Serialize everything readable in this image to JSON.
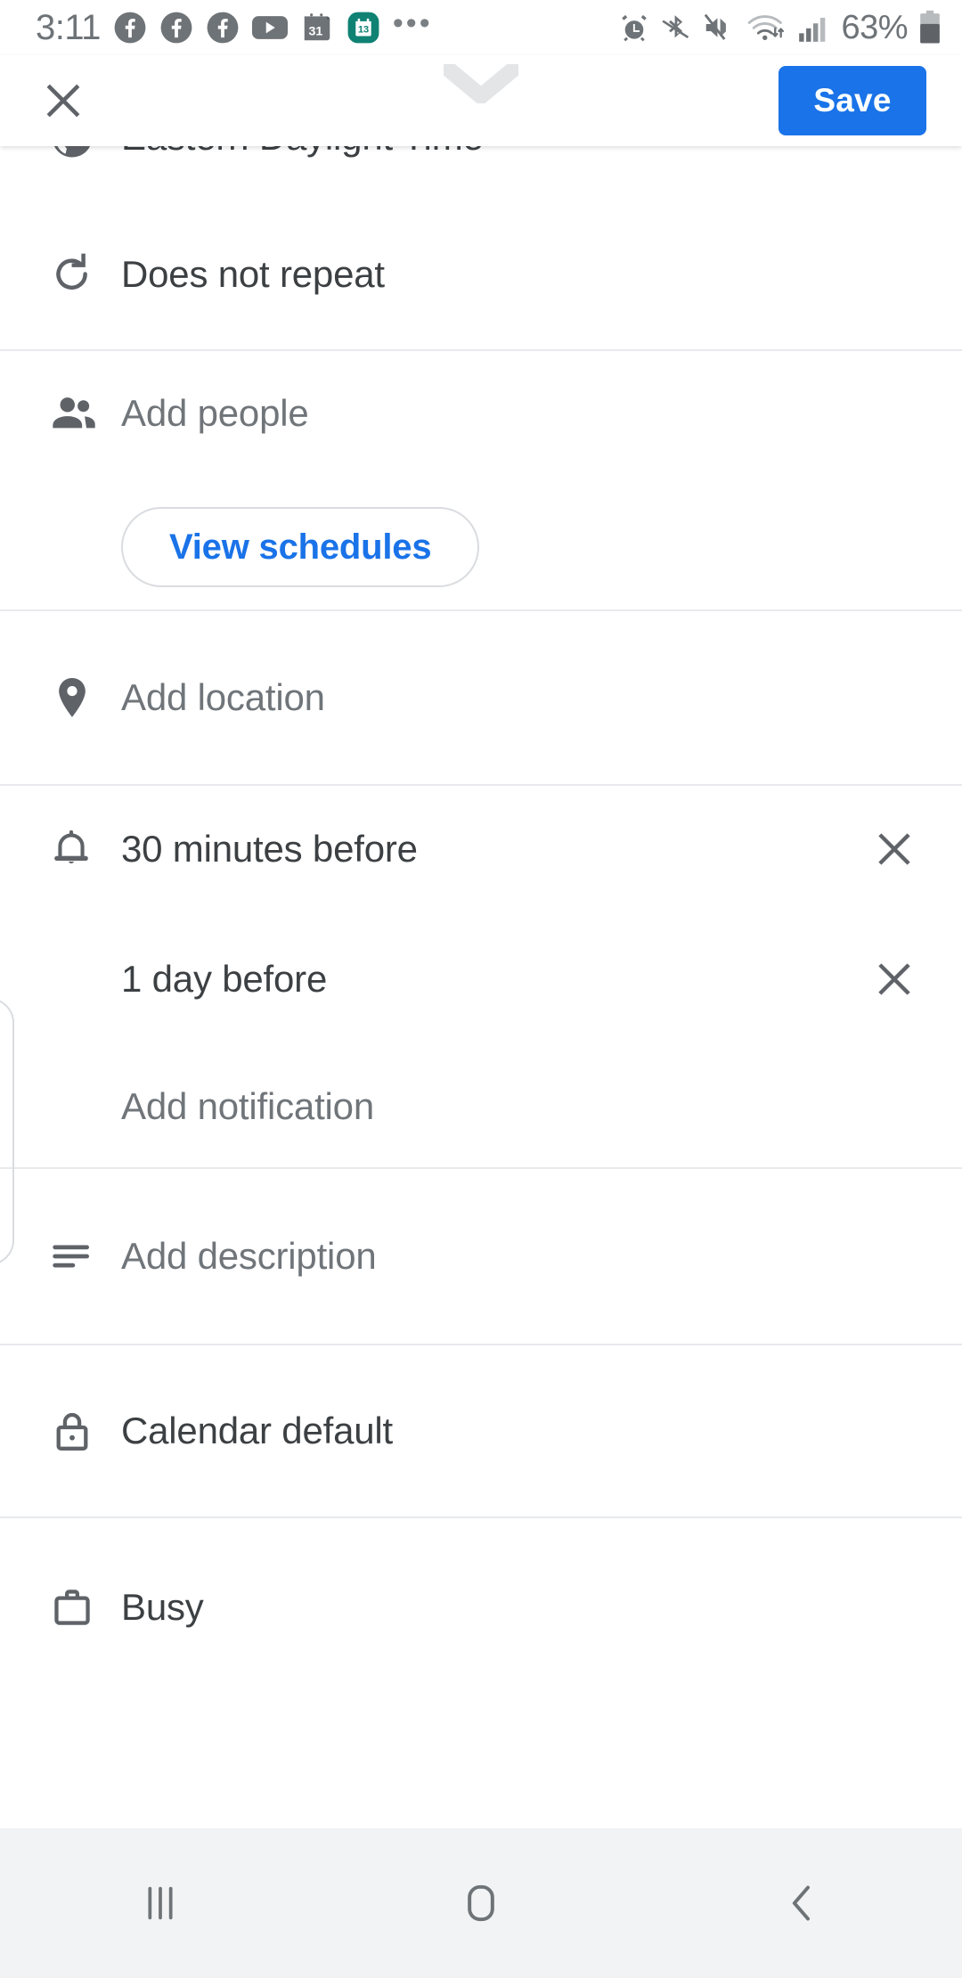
{
  "statusbar": {
    "time": "3:11",
    "battery_percent": "63%",
    "left_icons": [
      "facebook-icon",
      "facebook-icon",
      "facebook-icon",
      "youtube-icon",
      "calendar-31-icon",
      "calendar-13-icon"
    ],
    "overflow": "•••",
    "right_icons": [
      "alarm-icon",
      "bluetooth-icon",
      "volume-mute-icon",
      "wifi-icon",
      "signal-icon",
      "battery-icon"
    ],
    "calendar_31_label": "31",
    "calendar_13_label": "13",
    "teal_accent": "#0f8274",
    "icon_gray": "#6e7377"
  },
  "appbar": {
    "close_label": "close-icon",
    "save_label": "Save",
    "accent": "#1a73e8"
  },
  "form": {
    "rows": [
      {
        "icon": "globe-icon",
        "label": "Eastern Daylight Time",
        "type": "value",
        "clipped": true
      },
      {
        "icon": "repeat-icon",
        "label": "Does not repeat",
        "type": "value"
      },
      {
        "icon": "people-icon",
        "label": "Add people",
        "type": "placeholder"
      },
      {
        "icon": "none",
        "label": "View schedules",
        "type": "pill"
      },
      {
        "icon": "location-icon",
        "label": "Add location",
        "type": "placeholder"
      },
      {
        "icon": "bell-icon",
        "label": "30 minutes before",
        "type": "value-removable"
      },
      {
        "icon": "none",
        "label": "1 day before",
        "type": "value-removable"
      },
      {
        "icon": "none",
        "label": "Add notification",
        "type": "placeholder"
      },
      {
        "icon": "description-icon",
        "label": "Add description",
        "type": "placeholder"
      },
      {
        "icon": "lock-icon",
        "label": "Calendar default",
        "type": "value"
      },
      {
        "icon": "briefcase-icon",
        "label": "Busy",
        "type": "value"
      }
    ]
  },
  "navbar": {
    "recents_label": "recents-icon",
    "home_label": "home-icon",
    "back_label": "back-icon"
  }
}
